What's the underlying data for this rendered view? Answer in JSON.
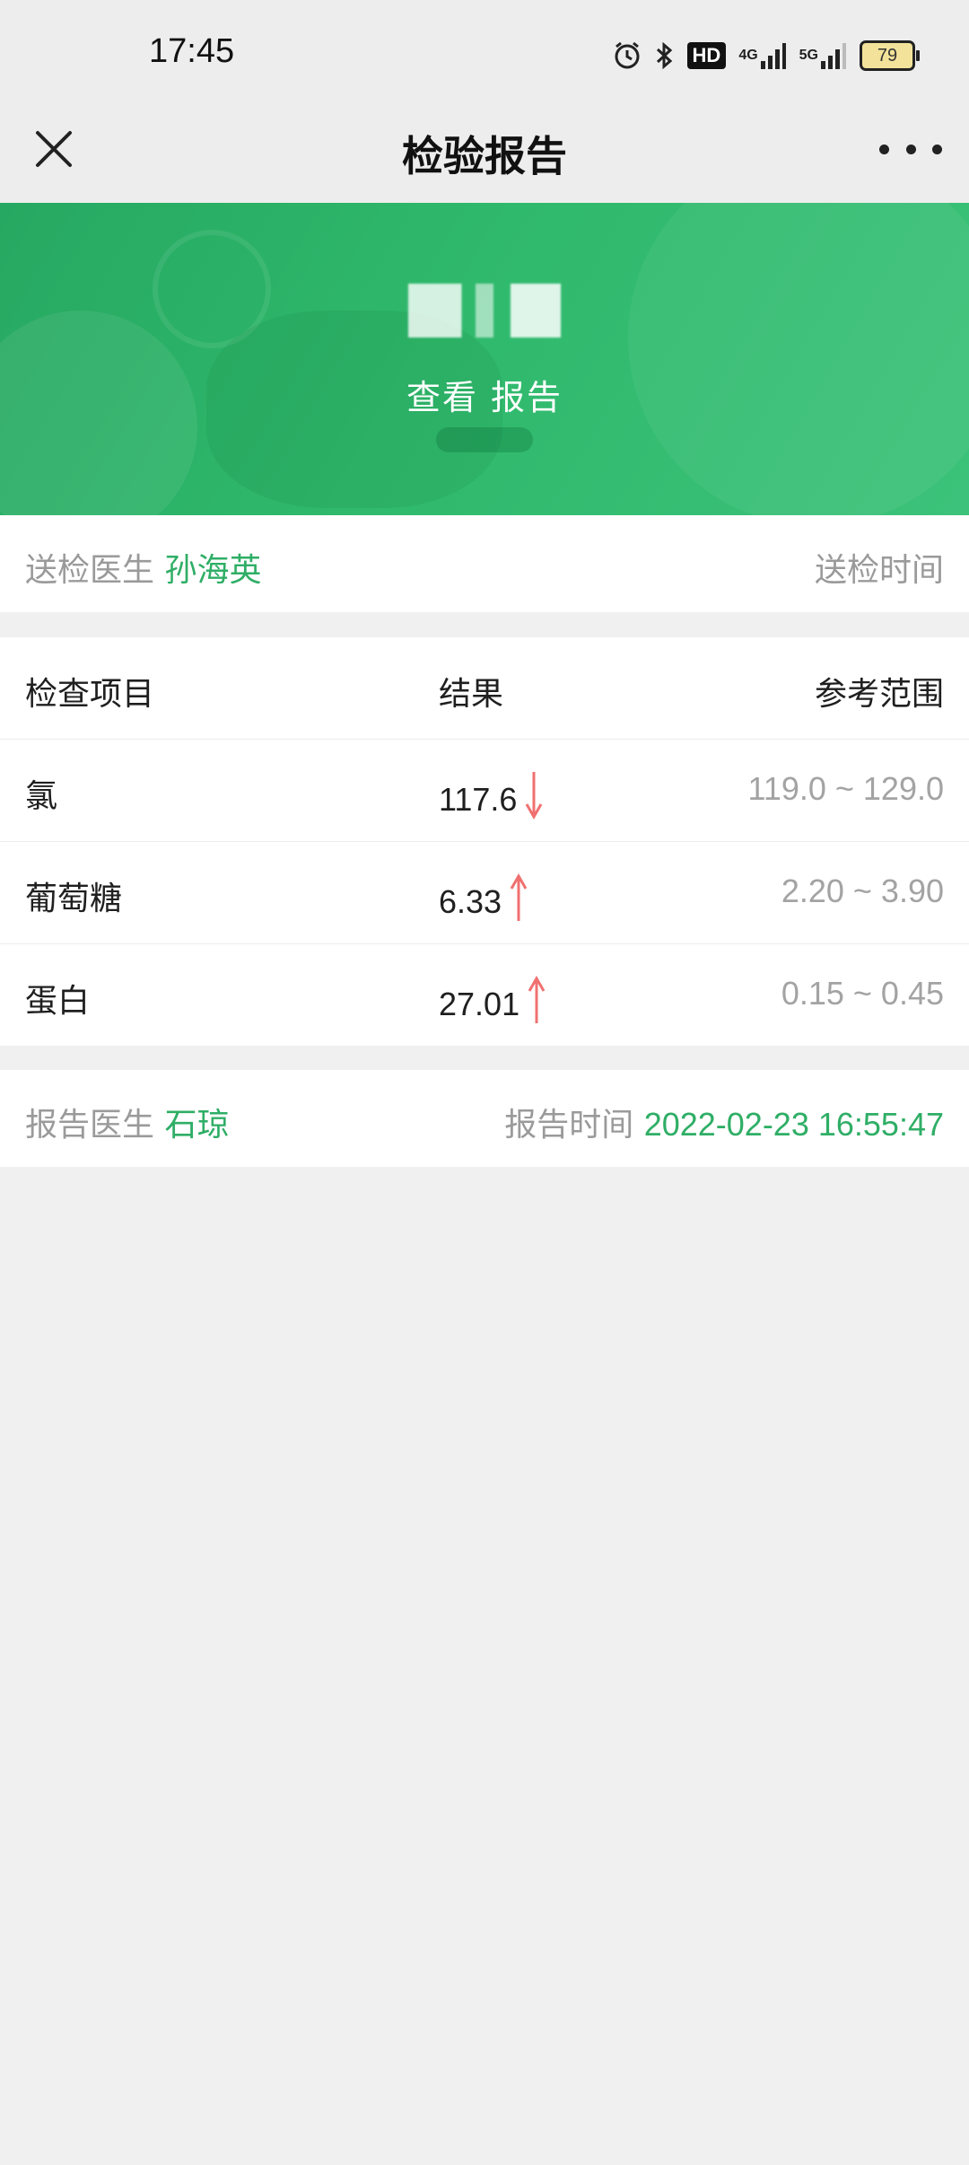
{
  "status": {
    "time": "17:45",
    "hd_label": "HD",
    "net1": "4G",
    "net2": "5G",
    "battery": "79"
  },
  "nav": {
    "title": "检验报告",
    "close_icon": "close-icon",
    "more_icon": "more-icon"
  },
  "banner": {
    "text": "查看 报告"
  },
  "send_info": {
    "doctor_label": "送检医生",
    "doctor_name": "孙海英",
    "time_label": "送检时间"
  },
  "table": {
    "headers": {
      "item": "检查项目",
      "result": "结果",
      "range": "参考范围"
    },
    "rows": [
      {
        "item": "氯",
        "result": "117.6",
        "flag": "down",
        "range": "119.0 ~ 129.0"
      },
      {
        "item": "葡萄糖",
        "result": "6.33",
        "flag": "up",
        "range": "2.20 ~ 3.90"
      },
      {
        "item": "蛋白",
        "result": "27.01",
        "flag": "up",
        "range": "0.15 ~ 0.45"
      }
    ]
  },
  "report_info": {
    "doctor_label": "报告医生",
    "doctor_name": "石琼",
    "time_label": "报告时间",
    "time_value": "2022-02-23 16:55:47"
  },
  "colors": {
    "accent": "#2fae66",
    "arrow": "#f07070",
    "banner": "#2fb96c"
  }
}
